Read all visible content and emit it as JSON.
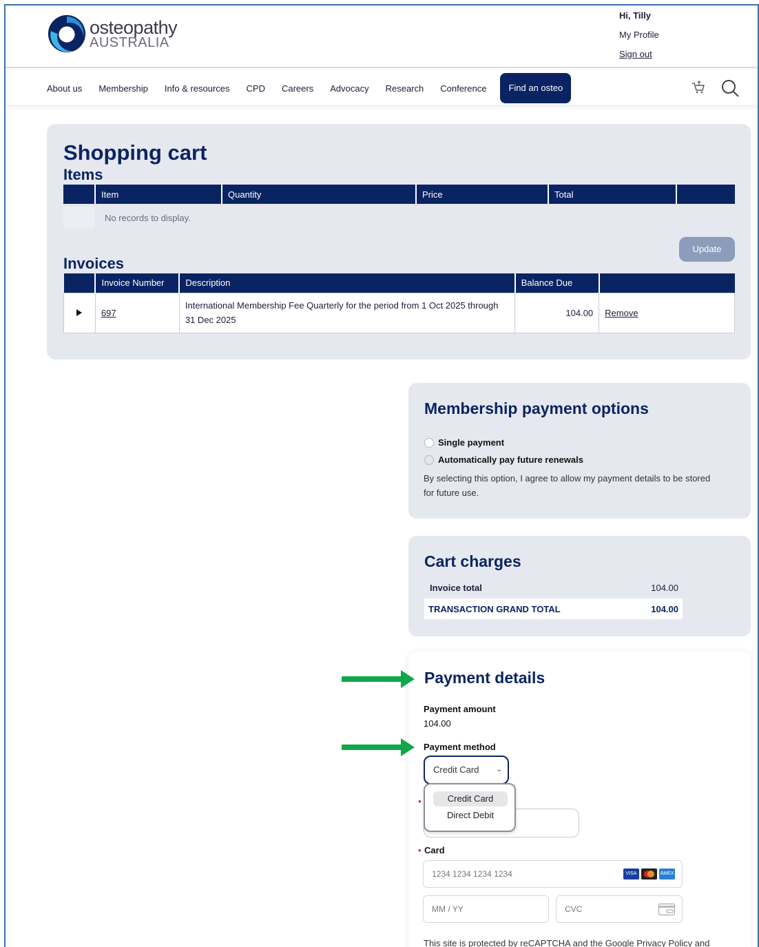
{
  "logo": {
    "line1": "osteopathy",
    "line2": "AUSTRALIA"
  },
  "user": {
    "greeting": "Hi, Tilly",
    "profile": "My Profile",
    "signout": "Sign out"
  },
  "nav": {
    "items": [
      "About us",
      "Membership",
      "Info & resources",
      "CPD",
      "Careers",
      "Advocacy",
      "Research",
      "Conference"
    ],
    "cta": "Find an osteo"
  },
  "cart": {
    "title": "Shopping cart",
    "items_heading": "Items",
    "items_columns": [
      "Item",
      "Quantity",
      "Price",
      "Total"
    ],
    "no_records": "No records to display.",
    "update_label": "Update",
    "invoices_heading": "Invoices",
    "invoice_columns": [
      "Invoice Number",
      "Description",
      "Balance Due"
    ],
    "invoices": [
      {
        "number": "697",
        "description": "International Membership Fee Quarterly for the period from 1 Oct 2025 through 31 Dec 2025",
        "balance": "104.00",
        "action": "Remove"
      }
    ]
  },
  "options": {
    "title": "Membership payment options",
    "single": "Single payment",
    "auto": "Automatically pay future renewals",
    "note": "By selecting this option, I agree to allow my payment details to be stored for future use."
  },
  "charges": {
    "title": "Cart charges",
    "invoice_total_label": "Invoice total",
    "invoice_total_value": "104.00",
    "grand_total_label": "TRANSACTION GRAND TOTAL",
    "grand_total_value": "104.00"
  },
  "payment": {
    "title": "Payment details",
    "amount_label": "Payment amount",
    "amount_value": "104.00",
    "method_label": "Payment method",
    "method_selected": "Credit Card",
    "method_options": [
      "Credit Card",
      "Direct Debit"
    ],
    "card_label": "Card",
    "card_placeholder": "1234 1234 1234 1234",
    "expiry_placeholder": "MM / YY",
    "cvc_placeholder": "CVC",
    "card_brands": [
      "VISA",
      "MC",
      "AMEX"
    ],
    "recaptcha_text": "This site is protected by reCAPTCHA and the Google Privacy Policy and"
  },
  "colors": {
    "navy": "#0a2463",
    "panel": "#e6e8ef",
    "arrow": "#10a84a",
    "required": "#d0202a"
  }
}
